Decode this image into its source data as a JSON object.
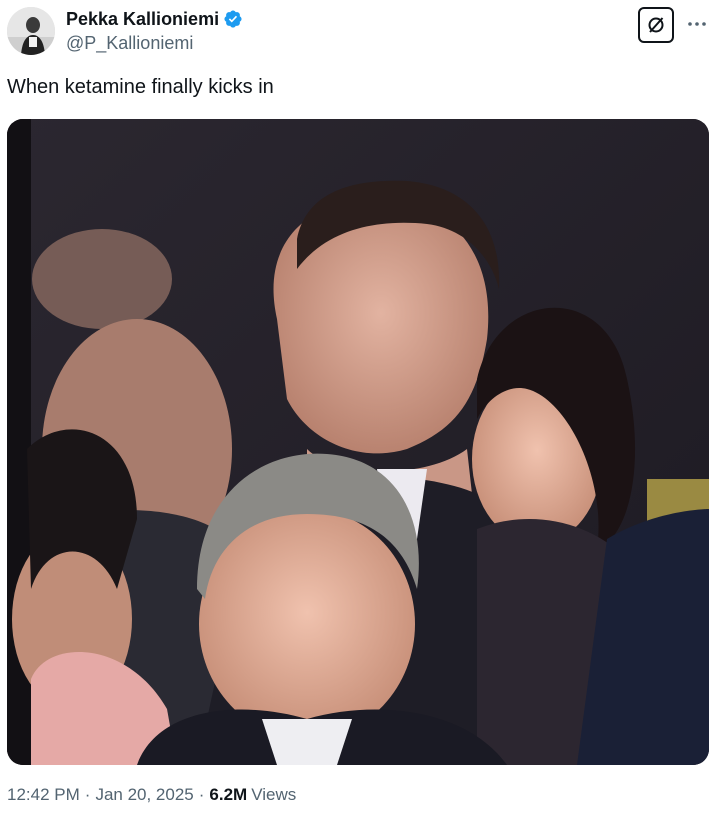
{
  "author": {
    "name": "Pekka Kallioniemi",
    "handle": "@P_Kallioniemi",
    "verified": true,
    "avatar_icon": "profile-photo",
    "verified_color": "#1d9bf0"
  },
  "header_actions": {
    "grok_icon": "grok-slash-icon",
    "more_icon": "more-dots-icon"
  },
  "tweet": {
    "text": "When ketamine finally kicks in"
  },
  "media": {
    "type": "video-still",
    "description_icon": "video-frame-image"
  },
  "meta": {
    "time": "12:42 PM",
    "separator": "·",
    "date": "Jan 20, 2025",
    "views_count": "6.2M",
    "views_label": "Views"
  },
  "colors": {
    "text_primary": "#0f1419",
    "text_secondary": "#536471",
    "accent": "#1d9bf0"
  }
}
